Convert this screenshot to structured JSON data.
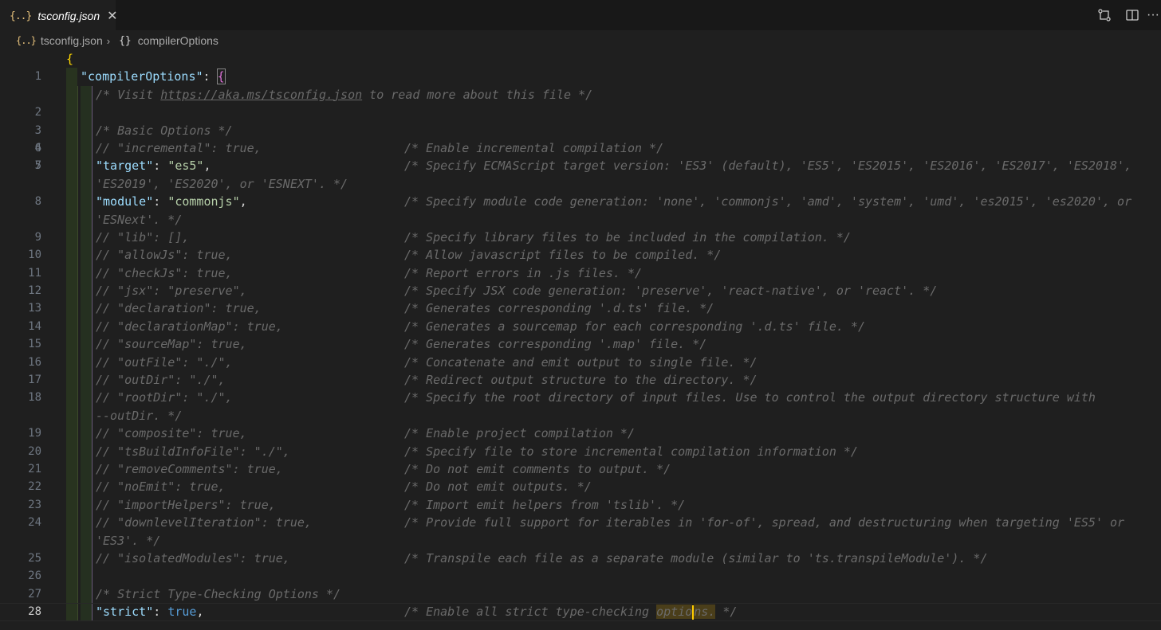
{
  "tab": {
    "icon": "{..}",
    "title": "tsconfig.json",
    "close": "✕"
  },
  "toolbar": {
    "compare_icon": "git-compare-icon",
    "split_icon": "split-editor-icon",
    "more": "···"
  },
  "breadcrumb": {
    "file_icon": "{..}",
    "file": "tsconfig.json",
    "sep": "›",
    "symbol_icon": "{}",
    "symbol": "compilerOptions"
  },
  "lines": [
    {
      "n": "1",
      "text": "{"
    },
    {
      "n": "2",
      "text": "\"compilerOptions\": {"
    },
    {
      "n": "3",
      "text": "/* Visit https://aka.ms/tsconfig.json to read more about this file */"
    },
    {
      "n": "4",
      "text": ""
    },
    {
      "n": "5",
      "text": "/* Basic Options */"
    },
    {
      "n": "6",
      "code": "// \"incremental\": true,",
      "comment": "/* Enable incremental compilation */"
    },
    {
      "n": "7",
      "code": "\"target\": \"es5\",",
      "comment": "/* Specify ECMAScript target version: 'ES3' (default), 'ES5', 'ES2015', 'ES2016', 'ES2017', 'ES2018',"
    },
    {
      "n": "",
      "wrap": "'ES2019', 'ES2020', or 'ESNEXT'. */"
    },
    {
      "n": "8",
      "code": "\"module\": \"commonjs\",",
      "comment": "/* Specify module code generation: 'none', 'commonjs', 'amd', 'system', 'umd', 'es2015', 'es2020', or"
    },
    {
      "n": "",
      "wrap": "'ESNext'. */"
    },
    {
      "n": "9",
      "code": "// \"lib\": [],",
      "comment": "/* Specify library files to be included in the compilation. */"
    },
    {
      "n": "10",
      "code": "// \"allowJs\": true,",
      "comment": "/* Allow javascript files to be compiled. */"
    },
    {
      "n": "11",
      "code": "// \"checkJs\": true,",
      "comment": "/* Report errors in .js files. */"
    },
    {
      "n": "12",
      "code": "// \"jsx\": \"preserve\",",
      "comment": "/* Specify JSX code generation: 'preserve', 'react-native', or 'react'. */"
    },
    {
      "n": "13",
      "code": "// \"declaration\": true,",
      "comment": "/* Generates corresponding '.d.ts' file. */"
    },
    {
      "n": "14",
      "code": "// \"declarationMap\": true,",
      "comment": "/* Generates a sourcemap for each corresponding '.d.ts' file. */"
    },
    {
      "n": "15",
      "code": "// \"sourceMap\": true,",
      "comment": "/* Generates corresponding '.map' file. */"
    },
    {
      "n": "16",
      "code": "// \"outFile\": \"./\",",
      "comment": "/* Concatenate and emit output to single file. */"
    },
    {
      "n": "17",
      "code": "// \"outDir\": \"./\",",
      "comment": "/* Redirect output structure to the directory. */"
    },
    {
      "n": "18",
      "code": "// \"rootDir\": \"./\",",
      "comment": "/* Specify the root directory of input files. Use to control the output directory structure with"
    },
    {
      "n": "",
      "wrap": "--outDir. */"
    },
    {
      "n": "19",
      "code": "// \"composite\": true,",
      "comment": "/* Enable project compilation */"
    },
    {
      "n": "20",
      "code": "// \"tsBuildInfoFile\": \"./\",",
      "comment": "/* Specify file to store incremental compilation information */"
    },
    {
      "n": "21",
      "code": "// \"removeComments\": true,",
      "comment": "/* Do not emit comments to output. */"
    },
    {
      "n": "22",
      "code": "// \"noEmit\": true,",
      "comment": "/* Do not emit outputs. */"
    },
    {
      "n": "23",
      "code": "// \"importHelpers\": true,",
      "comment": "/* Import emit helpers from 'tslib'. */"
    },
    {
      "n": "24",
      "code": "// \"downlevelIteration\": true,",
      "comment": "/* Provide full support for iterables in 'for-of', spread, and destructuring when targeting 'ES5' or"
    },
    {
      "n": "",
      "wrap": "'ES3'. */"
    },
    {
      "n": "25",
      "code": "// \"isolatedModules\": true,",
      "comment": "/* Transpile each file as a separate module (similar to 'ts.transpileModule'). */"
    },
    {
      "n": "26",
      "text": ""
    },
    {
      "n": "27",
      "text": "/* Strict Type-Checking Options */"
    },
    {
      "n": "28",
      "code": "\"strict\": true,",
      "comment": "/* Enable all strict type-checking options. */"
    }
  ]
}
